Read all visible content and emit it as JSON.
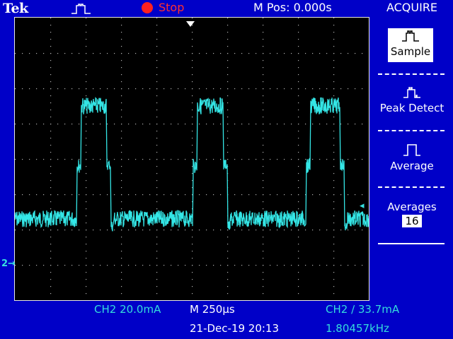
{
  "header": {
    "brand": "Tek",
    "run_state": "Stop",
    "m_pos": "M Pos: 0.000s"
  },
  "menu": {
    "title": "ACQUIRE",
    "items": [
      {
        "label": "Sample",
        "selected": true,
        "icon": "sample-waveform-icon"
      },
      {
        "label": "Peak Detect",
        "selected": false,
        "icon": "peak-detect-waveform-icon"
      },
      {
        "label": "Average",
        "selected": false,
        "icon": "average-waveform-icon"
      },
      {
        "label": "Averages",
        "value": "16"
      }
    ]
  },
  "status": {
    "ch2_scale": "CH2  20.0mA",
    "timebase": "M 250µs",
    "trigger": "CH2 ∕ 33.7mA",
    "date": "21-Dec-19 20:13",
    "frequency": "1.80457kHz"
  },
  "markers": {
    "trigger_level": "◂",
    "ch2_ground": "2→"
  },
  "colors": {
    "background": "#0000c8",
    "screen": "#000000",
    "trace": "#34e6e6",
    "stop": "#ff2020"
  }
}
